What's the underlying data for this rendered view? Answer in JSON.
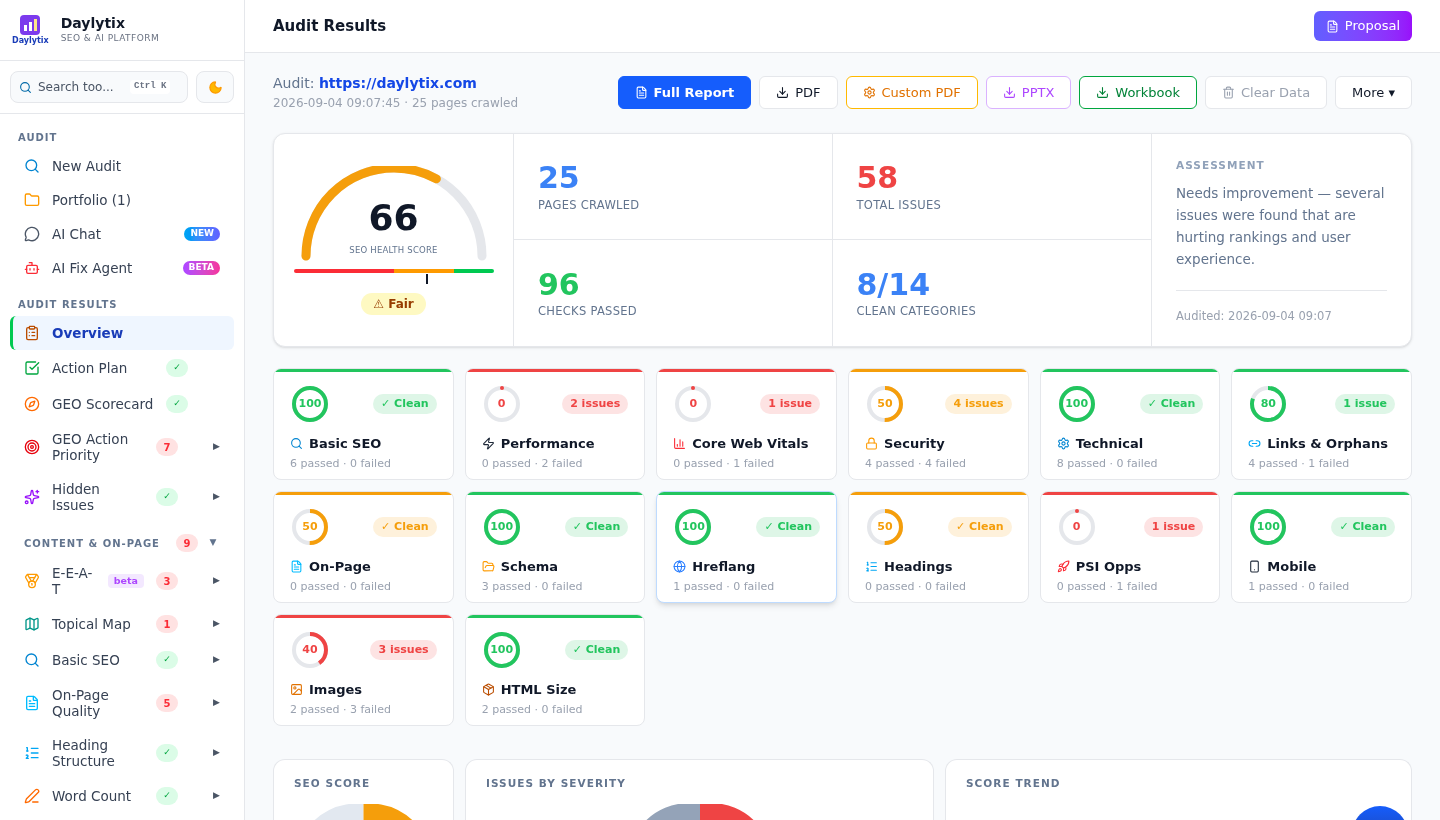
{
  "brand": {
    "name": "Daylytix",
    "logo_text": "Daylytix",
    "tagline": "SEO & AI PLATFORM"
  },
  "search": {
    "placeholder": "Search too...",
    "shortcut": "Ctrl K"
  },
  "sidebar": {
    "sections": [
      {
        "title": "AUDIT",
        "items": [
          {
            "label": "New Audit",
            "selected": false
          },
          {
            "label": "Portfolio (1)",
            "selected": false
          },
          {
            "label": "AI Chat",
            "selected": false,
            "badge": {
              "text": "NEW",
              "kind": "new"
            }
          },
          {
            "label": "AI Fix Agent",
            "selected": false,
            "badge": {
              "text": "BETA",
              "kind": "beta"
            }
          }
        ]
      },
      {
        "title": "AUDIT RESULTS",
        "items": [
          {
            "label": "Overview",
            "selected": true
          },
          {
            "label": "Action Plan",
            "selected": false,
            "badge": {
              "text": "✓",
              "kind": "ok"
            }
          },
          {
            "label": "GEO Scorecard",
            "selected": false,
            "badge": {
              "text": "✓",
              "kind": "ok"
            }
          },
          {
            "label": "GEO Action Priority",
            "selected": false,
            "badge": {
              "text": "7",
              "kind": "count"
            },
            "arrow": "▶"
          },
          {
            "label": "Hidden Issues",
            "selected": false,
            "badge": {
              "text": "✓",
              "kind": "ok"
            },
            "arrow": "▶"
          }
        ]
      },
      {
        "title": "CONTENT & ON-PAGE",
        "count": "9",
        "toggle": "▼",
        "items": [
          {
            "label": "E-E-A-T",
            "selected": false,
            "tag": "beta",
            "badge": {
              "text": "3",
              "kind": "count"
            },
            "arrow": "▶"
          },
          {
            "label": "Topical Map",
            "selected": false,
            "badge": {
              "text": "1",
              "kind": "count"
            },
            "arrow": "▶"
          },
          {
            "label": "Basic SEO",
            "selected": false,
            "badge": {
              "text": "✓",
              "kind": "ok"
            },
            "arrow": "▶"
          },
          {
            "label": "On-Page Quality",
            "selected": false,
            "badge": {
              "text": "5",
              "kind": "count"
            },
            "arrow": "▶"
          },
          {
            "label": "Heading Structure",
            "selected": false,
            "badge": {
              "text": "✓",
              "kind": "ok"
            },
            "arrow": "▶"
          },
          {
            "label": "Word Count",
            "selected": false,
            "badge": {
              "text": "✓",
              "kind": "ok"
            },
            "arrow": "▶"
          }
        ]
      }
    ]
  },
  "header": {
    "title": "Audit Results",
    "proposal_button": "Proposal"
  },
  "audit": {
    "label": "Audit:",
    "url": "https://daylytix.com",
    "meta": "2026-09-04 09:07:45 · 25 pages crawled"
  },
  "actions": [
    {
      "label": "Full Report",
      "kind": "primary"
    },
    {
      "label": "PDF",
      "kind": "neutral"
    },
    {
      "label": "Custom PDF",
      "kind": "amber"
    },
    {
      "label": "PPTX",
      "kind": "purple"
    },
    {
      "label": "Workbook",
      "kind": "green"
    },
    {
      "label": "Clear Data",
      "kind": "disabled"
    },
    {
      "label": "More ▾",
      "kind": "menu"
    }
  ],
  "health": {
    "score": "66",
    "label": "SEO HEALTH SCORE",
    "level": 0.66,
    "rating": "⚠ Fair"
  },
  "stats": [
    {
      "value": "25",
      "label": "PAGES CRAWLED",
      "color": "#3b82f6"
    },
    {
      "value": "58",
      "label": "TOTAL ISSUES",
      "color": "#ef4444"
    },
    {
      "value": "96",
      "label": "CHECKS PASSED",
      "color": "#22c55e"
    },
    {
      "value": "8/14",
      "label": "CLEAN CATEGORIES",
      "color": "#3b82f6"
    }
  ],
  "assessment": {
    "title": "ASSESSMENT",
    "text": "Needs improvement — several issues were found that are hurting rankings and user experience.",
    "audited": "Audited: 2026-09-04 09:07"
  },
  "categories": [
    {
      "name": "Basic SEO",
      "score": "100",
      "level": 1,
      "color": "#22c55e",
      "badge": "✓ Clean",
      "detail": "6 passed · 0 failed",
      "selected": false
    },
    {
      "name": "Performance",
      "score": "0",
      "level": 0,
      "color": "#ef4444",
      "badge": "2 issues",
      "detail": "0 passed · 2 failed",
      "selected": false
    },
    {
      "name": "Core Web Vitals",
      "score": "0",
      "level": 0,
      "color": "#ef4444",
      "badge": "1 issue",
      "detail": "0 passed · 1 failed",
      "selected": false
    },
    {
      "name": "Security",
      "score": "50",
      "level": 0.5,
      "color": "#f59e0b",
      "badge": "4 issues",
      "detail": "4 passed · 4 failed",
      "selected": false
    },
    {
      "name": "Technical",
      "score": "100",
      "level": 1,
      "color": "#22c55e",
      "badge": "✓ Clean",
      "detail": "8 passed · 0 failed",
      "selected": false
    },
    {
      "name": "Links & Orphans",
      "score": "80",
      "level": 0.8,
      "color": "#22c55e",
      "badge": "1 issue",
      "detail": "4 passed · 1 failed",
      "selected": false
    },
    {
      "name": "On-Page",
      "score": "50",
      "level": 0.5,
      "color": "#f59e0b",
      "badge": "✓ Clean",
      "detail": "0 passed · 0 failed",
      "selected": false
    },
    {
      "name": "Schema",
      "score": "100",
      "level": 1,
      "color": "#22c55e",
      "badge": "✓ Clean",
      "detail": "3 passed · 0 failed",
      "selected": false
    },
    {
      "name": "Hreflang",
      "score": "100",
      "level": 1,
      "color": "#22c55e",
      "badge": "✓ Clean",
      "detail": "1 passed · 0 failed",
      "selected": true
    },
    {
      "name": "Headings",
      "score": "50",
      "level": 0.5,
      "color": "#f59e0b",
      "badge": "✓ Clean",
      "detail": "0 passed · 0 failed",
      "selected": false
    },
    {
      "name": "PSI Opps",
      "score": "0",
      "level": 0,
      "color": "#ef4444",
      "badge": "1 issue",
      "detail": "0 passed · 1 failed",
      "selected": false
    },
    {
      "name": "Mobile",
      "score": "100",
      "level": 1,
      "color": "#22c55e",
      "badge": "✓ Clean",
      "detail": "1 passed · 0 failed",
      "selected": false
    },
    {
      "name": "Images",
      "score": "40",
      "level": 0.4,
      "color": "#ef4444",
      "badge": "3 issues",
      "detail": "2 passed · 3 failed",
      "selected": false
    },
    {
      "name": "HTML Size",
      "score": "100",
      "level": 1,
      "color": "#22c55e",
      "badge": "✓ Clean",
      "detail": "2 passed · 0 failed",
      "selected": false
    }
  ],
  "panels": [
    {
      "title": "SEO SCORE",
      "kind": "score_donut"
    },
    {
      "title": "ISSUES BY SEVERITY",
      "kind": "severity_donut"
    },
    {
      "title": "SCORE TREND",
      "kind": "trend"
    }
  ]
}
